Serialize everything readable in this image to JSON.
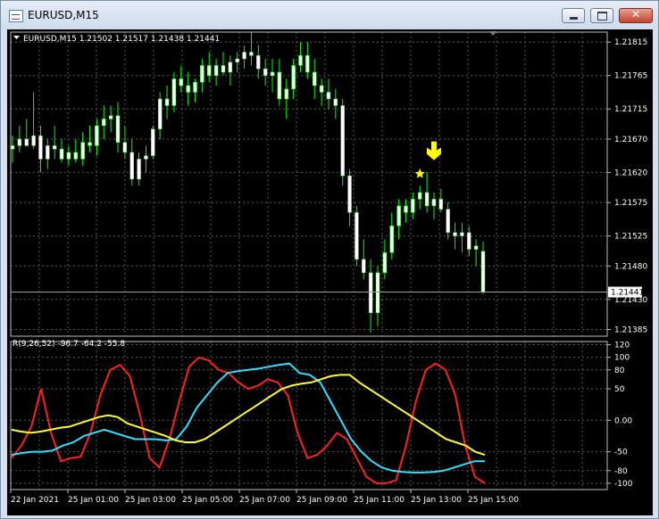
{
  "window": {
    "title": "EURUSD,M15",
    "close_glyph": "✕"
  },
  "chart_data": [
    {
      "type": "candlestick",
      "header": "EURUSD,M15  1.21502 1.21517 1.21438 1.21441",
      "y_ticks": [
        "1.21815",
        "1.21765",
        "1.21715",
        "1.21670",
        "1.21620",
        "1.21575",
        "1.21525",
        "1.21480",
        "1.21430",
        "1.21385"
      ],
      "ylim": [
        1.21375,
        1.2183
      ],
      "current_price": "1.21441",
      "bull_color": "#ffffff",
      "bear_color": "#ffffff",
      "wick_color": "#00ff00",
      "candles": [
        [
          1.21655,
          1.21675,
          1.21635,
          1.2166
        ],
        [
          1.2166,
          1.2169,
          1.2165,
          1.2167
        ],
        [
          1.2167,
          1.217,
          1.2166,
          1.2166
        ],
        [
          1.2166,
          1.2174,
          1.21655,
          1.21675
        ],
        [
          1.21675,
          1.2169,
          1.2162,
          1.2164
        ],
        [
          1.2164,
          1.2167,
          1.21625,
          1.2166
        ],
        [
          1.2166,
          1.2169,
          1.2164,
          1.21655
        ],
        [
          1.21655,
          1.2167,
          1.21635,
          1.2164
        ],
        [
          1.2164,
          1.2166,
          1.2163,
          1.2165
        ],
        [
          1.2165,
          1.2167,
          1.21635,
          1.2164
        ],
        [
          1.2164,
          1.2168,
          1.2163,
          1.21665
        ],
        [
          1.21665,
          1.2169,
          1.2165,
          1.2166
        ],
        [
          1.2166,
          1.217,
          1.21645,
          1.2169
        ],
        [
          1.2169,
          1.2172,
          1.2167,
          1.217
        ],
        [
          1.217,
          1.2172,
          1.2168,
          1.21705
        ],
        [
          1.21705,
          1.21725,
          1.2165,
          1.21665
        ],
        [
          1.21665,
          1.2169,
          1.2164,
          1.2165
        ],
        [
          1.2165,
          1.2167,
          1.216,
          1.2161
        ],
        [
          1.2161,
          1.2165,
          1.216,
          1.2164
        ],
        [
          1.2164,
          1.2166,
          1.2162,
          1.21645
        ],
        [
          1.21645,
          1.2169,
          1.2164,
          1.21685
        ],
        [
          1.21685,
          1.2174,
          1.2167,
          1.2173
        ],
        [
          1.2173,
          1.2175,
          1.217,
          1.2172
        ],
        [
          1.2172,
          1.2177,
          1.2171,
          1.2176
        ],
        [
          1.2176,
          1.2178,
          1.2174,
          1.2175
        ],
        [
          1.2175,
          1.2177,
          1.2172,
          1.2174
        ],
        [
          1.2174,
          1.2176,
          1.21725,
          1.21755
        ],
        [
          1.21755,
          1.2179,
          1.2174,
          1.2178
        ],
        [
          1.2178,
          1.218,
          1.21755,
          1.21765
        ],
        [
          1.21765,
          1.2179,
          1.2175,
          1.2178
        ],
        [
          1.2178,
          1.218,
          1.21765,
          1.2177
        ],
        [
          1.2177,
          1.21795,
          1.2175,
          1.21785
        ],
        [
          1.21785,
          1.218,
          1.2177,
          1.2179
        ],
        [
          1.2179,
          1.2181,
          1.21775,
          1.218
        ],
        [
          1.218,
          1.2183,
          1.2178,
          1.21795
        ],
        [
          1.21795,
          1.2181,
          1.2176,
          1.21775
        ],
        [
          1.21775,
          1.2179,
          1.2175,
          1.21765
        ],
        [
          1.21765,
          1.2179,
          1.2174,
          1.2177
        ],
        [
          1.2177,
          1.2179,
          1.2172,
          1.2173
        ],
        [
          1.2173,
          1.2176,
          1.217,
          1.21745
        ],
        [
          1.21745,
          1.2179,
          1.2173,
          1.2178
        ],
        [
          1.2178,
          1.21815,
          1.2177,
          1.21795
        ],
        [
          1.21795,
          1.21815,
          1.2176,
          1.2177
        ],
        [
          1.2177,
          1.2179,
          1.2173,
          1.2175
        ],
        [
          1.2175,
          1.2176,
          1.2172,
          1.2174
        ],
        [
          1.2174,
          1.2176,
          1.21715,
          1.2173
        ],
        [
          1.2173,
          1.21745,
          1.217,
          1.2172
        ],
        [
          1.2172,
          1.2173,
          1.216,
          1.21615
        ],
        [
          1.21615,
          1.21625,
          1.2154,
          1.2156
        ],
        [
          1.2156,
          1.2157,
          1.2148,
          1.2149
        ],
        [
          1.2149,
          1.2152,
          1.2146,
          1.2147
        ],
        [
          1.2147,
          1.2149,
          1.2138,
          1.2141
        ],
        [
          1.2141,
          1.2148,
          1.2139,
          1.2147
        ],
        [
          1.2147,
          1.2152,
          1.2146,
          1.215
        ],
        [
          1.215,
          1.2156,
          1.2149,
          1.2154
        ],
        [
          1.2154,
          1.2158,
          1.2152,
          1.2157
        ],
        [
          1.2157,
          1.2158,
          1.21545,
          1.2156
        ],
        [
          1.2156,
          1.2159,
          1.2155,
          1.2158
        ],
        [
          1.2158,
          1.216,
          1.21565,
          1.2159
        ],
        [
          1.2159,
          1.2162,
          1.2156,
          1.2157
        ],
        [
          1.2157,
          1.2159,
          1.2155,
          1.2158
        ],
        [
          1.2158,
          1.21595,
          1.2156,
          1.21565
        ],
        [
          1.21565,
          1.21575,
          1.2152,
          1.2153
        ],
        [
          1.2153,
          1.21545,
          1.21505,
          1.21525
        ],
        [
          1.21525,
          1.21545,
          1.215,
          1.2153
        ],
        [
          1.2153,
          1.2154,
          1.21495,
          1.21505
        ],
        [
          1.21505,
          1.2152,
          1.2148,
          1.2151
        ],
        [
          1.21502,
          1.21517,
          1.21438,
          1.21441
        ]
      ],
      "signal_star": {
        "index": 58,
        "price": 1.21618,
        "color": "#ffff00"
      },
      "signal_arrow": {
        "index": 60,
        "price": 1.21645,
        "color": "#ffff00"
      }
    },
    {
      "type": "line",
      "header": "R(9,26,52) -96.7 -64.2 -55.8",
      "y_ticks": [
        "120",
        "100",
        "80",
        "50",
        "0.00",
        "-50",
        "-80",
        "-100"
      ],
      "ylim": [
        -110,
        125
      ],
      "x_labels": [
        "22 Jan 2021",
        "25 Jan 01:00",
        "25 Jan 03:00",
        "25 Jan 05:00",
        "25 Jan 07:00",
        "25 Jan 09:00",
        "25 Jan 11:00",
        "25 Jan 13:00",
        "25 Jan 15:00"
      ],
      "series": [
        {
          "color": "#ff2020",
          "values": [
            -60,
            -40,
            -10,
            50,
            -20,
            -65,
            -60,
            -58,
            -20,
            40,
            80,
            88,
            70,
            10,
            -60,
            -75,
            -30,
            30,
            85,
            100,
            95,
            80,
            75,
            60,
            50,
            55,
            65,
            60,
            40,
            -20,
            -60,
            -55,
            -40,
            -20,
            -30,
            -60,
            -90,
            -100,
            -100,
            -95,
            -40,
            30,
            80,
            90,
            80,
            40,
            -40,
            -90,
            -100
          ]
        },
        {
          "color": "#30e0ff",
          "values": [
            -55,
            -52,
            -50,
            -50,
            -48,
            -40,
            -35,
            -25,
            -20,
            -15,
            -20,
            -25,
            -30,
            -30,
            -30,
            -32,
            -30,
            -10,
            20,
            40,
            60,
            75,
            78,
            80,
            82,
            85,
            88,
            90,
            75,
            72,
            60,
            30,
            0,
            -30,
            -50,
            -65,
            -75,
            -80,
            -82,
            -83,
            -83,
            -82,
            -80,
            -75,
            -70,
            -65,
            -65
          ]
        },
        {
          "color": "#ffff30",
          "values": [
            -15,
            -18,
            -20,
            -18,
            -15,
            -12,
            -10,
            -5,
            0,
            5,
            8,
            5,
            -5,
            -10,
            -15,
            -20,
            -25,
            -32,
            -35,
            -35,
            -30,
            -20,
            -10,
            0,
            10,
            20,
            30,
            40,
            50,
            55,
            58,
            60,
            65,
            70,
            72,
            72,
            60,
            50,
            40,
            30,
            20,
            10,
            0,
            -10,
            -20,
            -30,
            -35,
            -40,
            -50,
            -55
          ]
        }
      ]
    }
  ]
}
